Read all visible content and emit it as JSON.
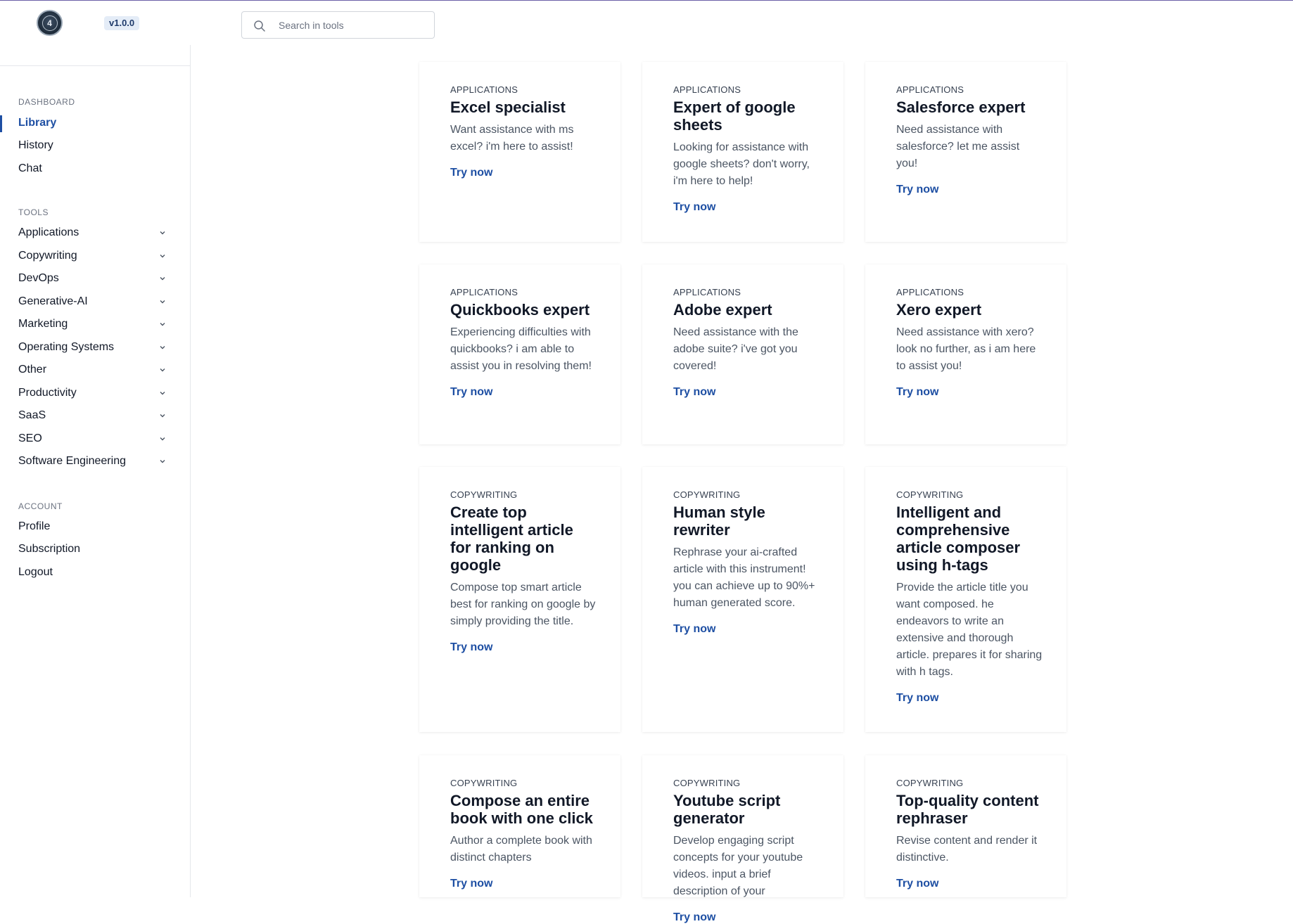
{
  "header": {
    "logo_text": "4",
    "version": "v1.0.0",
    "search_placeholder": "Search in tools"
  },
  "sidebar": {
    "dashboard_title": "DASHBOARD",
    "dashboard_items": [
      "Library",
      "History",
      "Chat"
    ],
    "tools_title": "TOOLS",
    "tools_items": [
      "Applications",
      "Copywriting",
      "DevOps",
      "Generative-AI",
      "Marketing",
      "Operating Systems",
      "Other",
      "Productivity",
      "SaaS",
      "SEO",
      "Software Engineering"
    ],
    "account_title": "ACCOUNT",
    "account_items": [
      "Profile",
      "Subscription",
      "Logout"
    ]
  },
  "cards": [
    {
      "category": "APPLICATIONS",
      "title": "Excel specialist",
      "description": "Want assistance with ms excel? i'm here to assist!",
      "cta": "Try now"
    },
    {
      "category": "APPLICATIONS",
      "title": "Expert of google sheets",
      "description": "Looking for assistance with google sheets? don't worry, i'm here to help!",
      "cta": "Try now"
    },
    {
      "category": "APPLICATIONS",
      "title": "Salesforce expert",
      "description": "Need assistance with salesforce? let me assist you!",
      "cta": "Try now"
    },
    {
      "category": "APPLICATIONS",
      "title": "Quickbooks expert",
      "description": "Experiencing difficulties with quickbooks? i am able to assist you in resolving them!",
      "cta": "Try now"
    },
    {
      "category": "APPLICATIONS",
      "title": "Adobe expert",
      "description": "Need assistance with the adobe suite? i've got you covered!",
      "cta": "Try now"
    },
    {
      "category": "APPLICATIONS",
      "title": "Xero expert",
      "description": "Need assistance with xero? look no further, as i am here to assist you!",
      "cta": "Try now"
    },
    {
      "category": "COPYWRITING",
      "title": "Create top intelligent article for ranking on google",
      "description": "Compose top smart article best for ranking on google by simply providing the title.",
      "cta": "Try now"
    },
    {
      "category": "COPYWRITING",
      "title": "Human style rewriter",
      "description": "Rephrase your ai-crafted article with this instrument! you can achieve up to 90%+ human generated score.",
      "cta": "Try now"
    },
    {
      "category": "COPYWRITING",
      "title": "Intelligent and comprehensive article composer using h-tags",
      "description": "Provide the article title you want composed. he endeavors to write an extensive and thorough article. prepares it for sharing with h tags.",
      "cta": "Try now"
    },
    {
      "category": "COPYWRITING",
      "title": "Compose an entire book with one click",
      "description": "Author a complete book with distinct chapters",
      "cta": "Try now"
    },
    {
      "category": "COPYWRITING",
      "title": "Youtube script generator",
      "description": "Develop engaging script concepts for your youtube videos. input a brief description of your",
      "cta": "Try now"
    },
    {
      "category": "COPYWRITING",
      "title": "Top-quality content rephraser",
      "description": "Revise content and render it distinctive.",
      "cta": "Try now"
    }
  ]
}
